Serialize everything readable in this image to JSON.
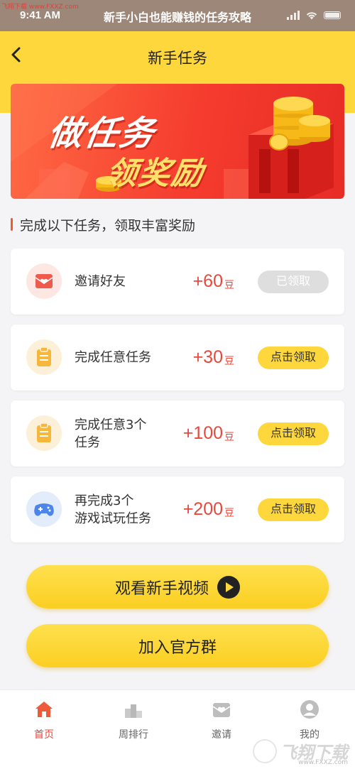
{
  "overlay": {
    "site": "飞翔下载 www.FXXZ.com",
    "time": "9:41 AM",
    "article_title": "新手小白也能赚钱的任务攻略"
  },
  "nav": {
    "title": "新手任务",
    "back_icon": "chevron-left-icon"
  },
  "banner": {
    "line1": "做任务",
    "line2": "领奖励"
  },
  "section": {
    "title": "完成以下任务，领取丰富奖励"
  },
  "tasks": [
    {
      "icon": "envelope-heart-icon",
      "name": "邀请好友",
      "reward": "+60",
      "unit": "豆",
      "button": "已领取",
      "claimed": true
    },
    {
      "icon": "clipboard-icon",
      "name": "完成任意任务",
      "reward": "+30",
      "unit": "豆",
      "button": "点击领取",
      "claimed": false
    },
    {
      "icon": "clipboard-icon",
      "name_line1": "完成任意3个",
      "name_line2": "任务",
      "reward": "+100",
      "unit": "豆",
      "button": "点击领取",
      "claimed": false
    },
    {
      "icon": "gamepad-icon",
      "name_line1": "再完成3个",
      "name_line2": "游戏试玩任务",
      "reward": "+200",
      "unit": "豆",
      "button": "点击领取",
      "claimed": false
    }
  ],
  "actions": {
    "watch_video": "观看新手视频",
    "join_group": "加入官方群"
  },
  "tabbar": {
    "items": [
      {
        "label": "首页",
        "icon": "home-icon",
        "active": true
      },
      {
        "label": "周排行",
        "icon": "podium-icon",
        "active": false
      },
      {
        "label": "邀请",
        "icon": "invite-envelope-icon",
        "active": false
      },
      {
        "label": "我的",
        "icon": "user-icon",
        "active": false
      }
    ]
  },
  "watermark": {
    "text": "飞翔下载",
    "url": "www.FXXZ.com"
  },
  "colors": {
    "brand_yellow": "#fdd73c",
    "reward_red": "#e8473b",
    "banner_red": "#f53c2e",
    "claimed_gray": "#dedede"
  }
}
